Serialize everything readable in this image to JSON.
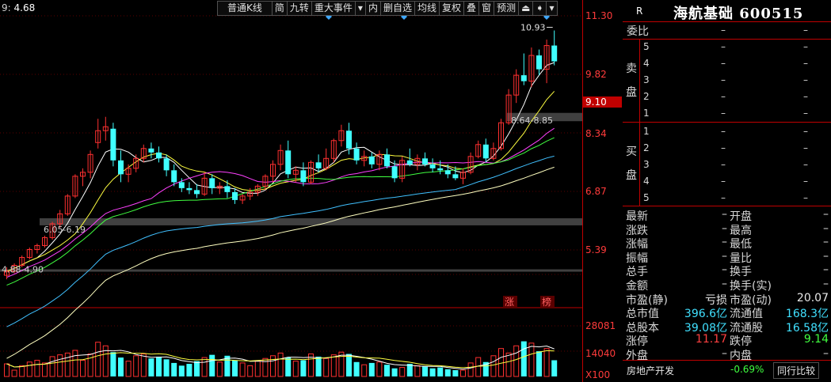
{
  "indicator": {
    "name": "9",
    "value": "4.68"
  },
  "toolbar": {
    "kline_type": "普通K线",
    "jian": "简",
    "jiuzhuan": "九转",
    "major_events": "重大事件",
    "nei": "内",
    "delete_custom": "删自选",
    "ma_lines": "均线",
    "fuquan": "复权",
    "overlay": "叠",
    "window": "窗",
    "forecast": "预测"
  },
  "chart": {
    "price_axis": [
      "11.30",
      "9.82",
      "9.10",
      "8.34",
      "6.87",
      "5.39"
    ],
    "volume_axis": [
      "28081",
      "14040",
      "X100"
    ],
    "annotations": {
      "high": "10.93",
      "gap_upper": "8.64-8.85",
      "gap_middle": "6.05-6.19",
      "gap_lower": "4.88-4.90",
      "zhang": "涨",
      "bang": "榜"
    },
    "colors": {
      "up": "#ff3030",
      "down": "#40ffff",
      "ma5": "#ffffff",
      "ma10": "#ffff40",
      "ma20": "#ff40ff",
      "ma30": "#40ff40",
      "ma60": "#40c0ff",
      "ma120": "#ffffc0"
    },
    "candles": [
      [
        4.75,
        4.95,
        4.65,
        4.85
      ],
      [
        4.85,
        5.05,
        4.8,
        5.0
      ],
      [
        5.0,
        5.25,
        4.95,
        5.2
      ],
      [
        5.2,
        5.45,
        5.15,
        5.4
      ],
      [
        5.4,
        5.55,
        5.3,
        5.5
      ],
      [
        5.5,
        5.75,
        5.45,
        5.7
      ],
      [
        5.7,
        6.1,
        5.65,
        6.05
      ],
      [
        6.05,
        6.4,
        5.95,
        6.3
      ],
      [
        6.3,
        6.8,
        6.25,
        6.75
      ],
      [
        6.75,
        7.3,
        6.7,
        7.25
      ],
      [
        7.25,
        7.45,
        7.0,
        7.35
      ],
      [
        7.35,
        7.9,
        7.2,
        7.8
      ],
      [
        8.1,
        8.7,
        7.95,
        8.4
      ],
      [
        8.4,
        8.75,
        8.15,
        8.5
      ],
      [
        8.45,
        8.6,
        7.5,
        7.65
      ],
      [
        7.65,
        7.9,
        7.1,
        7.3
      ],
      [
        7.3,
        7.55,
        7.1,
        7.45
      ],
      [
        7.45,
        7.8,
        7.35,
        7.7
      ],
      [
        7.7,
        8.05,
        7.6,
        7.95
      ],
      [
        7.95,
        8.1,
        7.7,
        7.85
      ],
      [
        7.85,
        8.0,
        7.6,
        7.7
      ],
      [
        7.7,
        7.8,
        7.25,
        7.4
      ],
      [
        7.4,
        7.55,
        7.0,
        7.1
      ],
      [
        7.1,
        7.2,
        6.85,
        6.95
      ],
      [
        6.95,
        7.1,
        6.8,
        6.9
      ],
      [
        6.9,
        7.05,
        6.7,
        6.8
      ],
      [
        6.8,
        7.35,
        6.75,
        7.2
      ],
      [
        7.2,
        7.3,
        6.8,
        6.95
      ],
      [
        6.95,
        7.1,
        6.8,
        7.0
      ],
      [
        7.0,
        7.15,
        6.7,
        6.85
      ],
      [
        6.85,
        6.95,
        6.55,
        6.65
      ],
      [
        6.65,
        6.8,
        6.55,
        6.75
      ],
      [
        6.75,
        6.95,
        6.65,
        6.85
      ],
      [
        6.85,
        7.05,
        6.75,
        7.0
      ],
      [
        7.0,
        7.3,
        6.9,
        7.25
      ],
      [
        7.25,
        7.65,
        7.1,
        7.55
      ],
      [
        7.55,
        8.05,
        7.4,
        7.9
      ],
      [
        7.9,
        8.15,
        7.2,
        7.3
      ],
      [
        7.3,
        7.5,
        7.1,
        7.4
      ],
      [
        7.4,
        7.6,
        7.0,
        7.1
      ],
      [
        7.1,
        7.65,
        7.05,
        7.6
      ],
      [
        7.6,
        7.8,
        7.35,
        7.45
      ],
      [
        7.45,
        7.95,
        7.4,
        7.7
      ],
      [
        7.7,
        8.2,
        7.6,
        8.15
      ],
      [
        8.15,
        8.55,
        8.0,
        8.4
      ],
      [
        8.4,
        8.6,
        7.8,
        7.95
      ],
      [
        7.95,
        8.1,
        7.55,
        7.65
      ],
      [
        7.65,
        7.9,
        7.5,
        7.75
      ],
      [
        7.75,
        7.85,
        7.45,
        7.55
      ],
      [
        7.55,
        7.9,
        7.4,
        7.8
      ],
      [
        7.8,
        7.95,
        7.45,
        7.5
      ],
      [
        7.5,
        7.65,
        7.1,
        7.2
      ],
      [
        7.2,
        7.75,
        7.1,
        7.65
      ],
      [
        7.65,
        7.95,
        7.5,
        7.55
      ],
      [
        7.55,
        7.8,
        7.4,
        7.7
      ],
      [
        7.7,
        7.85,
        7.5,
        7.55
      ],
      [
        7.55,
        7.7,
        7.35,
        7.45
      ],
      [
        7.45,
        7.65,
        7.3,
        7.4
      ],
      [
        7.4,
        7.55,
        7.2,
        7.3
      ],
      [
        7.3,
        7.5,
        7.15,
        7.2
      ],
      [
        7.2,
        7.45,
        7.05,
        7.35
      ],
      [
        7.35,
        7.85,
        7.3,
        7.75
      ],
      [
        7.75,
        8.15,
        7.7,
        8.05
      ],
      [
        8.05,
        8.2,
        7.6,
        7.7
      ],
      [
        7.7,
        8.1,
        7.65,
        7.95
      ],
      [
        7.95,
        8.7,
        7.9,
        8.6
      ],
      [
        8.6,
        9.45,
        8.55,
        9.3
      ],
      [
        9.3,
        9.95,
        9.1,
        9.8
      ],
      [
        9.8,
        10.35,
        9.55,
        9.65
      ],
      [
        9.65,
        10.5,
        9.5,
        10.3
      ],
      [
        10.3,
        10.45,
        9.8,
        9.95
      ],
      [
        9.95,
        10.7,
        9.6,
        10.55
      ],
      [
        10.55,
        10.93,
        10.05,
        10.15
      ]
    ],
    "volumes": [
      7000,
      3500,
      6000,
      8000,
      9000,
      7500,
      11000,
      12000,
      13000,
      14500,
      9000,
      12500,
      19000,
      17000,
      13500,
      10500,
      8500,
      11500,
      12500,
      10000,
      11000,
      9500,
      7500,
      6000,
      7000,
      8500,
      10500,
      12000,
      8000,
      11500,
      9000,
      7500,
      6000,
      8500,
      10000,
      11500,
      13000,
      10500,
      8500,
      9000,
      12500,
      11000,
      10000,
      12000,
      13500,
      12500,
      8000,
      6500,
      7500,
      8000,
      6500,
      4500,
      5000,
      7000,
      6000,
      5500,
      4500,
      5000,
      4000,
      3500,
      3500,
      7500,
      10500,
      8000,
      11500,
      15500,
      13000,
      17000,
      19500,
      18500,
      14000,
      15500,
      9000
    ],
    "x_dates": []
  },
  "quote": {
    "r_label": "R",
    "stock_name": "海航基础 600515",
    "weibi": "委比",
    "weibi_value": "–",
    "sell_side": "卖盘",
    "buy_side": "买盘",
    "sell_levels": [
      "5",
      "4",
      "3",
      "2",
      "1"
    ],
    "buy_levels": [
      "1",
      "2",
      "3",
      "4",
      "5"
    ],
    "dash": "–",
    "stats": [
      {
        "k1": "最新",
        "v1": "–",
        "k2": "开盘",
        "v2": "–"
      },
      {
        "k1": "涨跌",
        "v1": "–",
        "k2": "最高",
        "v2": "–"
      },
      {
        "k1": "涨幅",
        "v1": "–",
        "k2": "最低",
        "v2": "–"
      },
      {
        "k1": "振幅",
        "v1": "–",
        "k2": "量比",
        "v2": "–"
      },
      {
        "k1": "总手",
        "v1": "–",
        "k2": "换手",
        "v2": "–"
      },
      {
        "k1": "金额",
        "v1": "–",
        "k2": "换手(实)",
        "v2": "–"
      },
      {
        "k1": "市盈(静)",
        "v1": "亏损",
        "k2": "市盈(动)",
        "v2": "20.07"
      },
      {
        "k1": "总市值",
        "v1": "396.6亿",
        "k2": "流通值",
        "v2": "168.3亿"
      },
      {
        "k1": "总股本",
        "v1": "39.08亿",
        "k2": "流通股",
        "v2": "16.58亿"
      },
      {
        "k1": "涨停",
        "v1": "11.17",
        "k2": "跌停",
        "v2": "9.14"
      },
      {
        "k1": "外盘",
        "v1": "–",
        "k2": "内盘",
        "v2": "–"
      }
    ],
    "industry": "房地产开发",
    "industry_pct": "-0.69%",
    "compare_button": "同行比较"
  }
}
